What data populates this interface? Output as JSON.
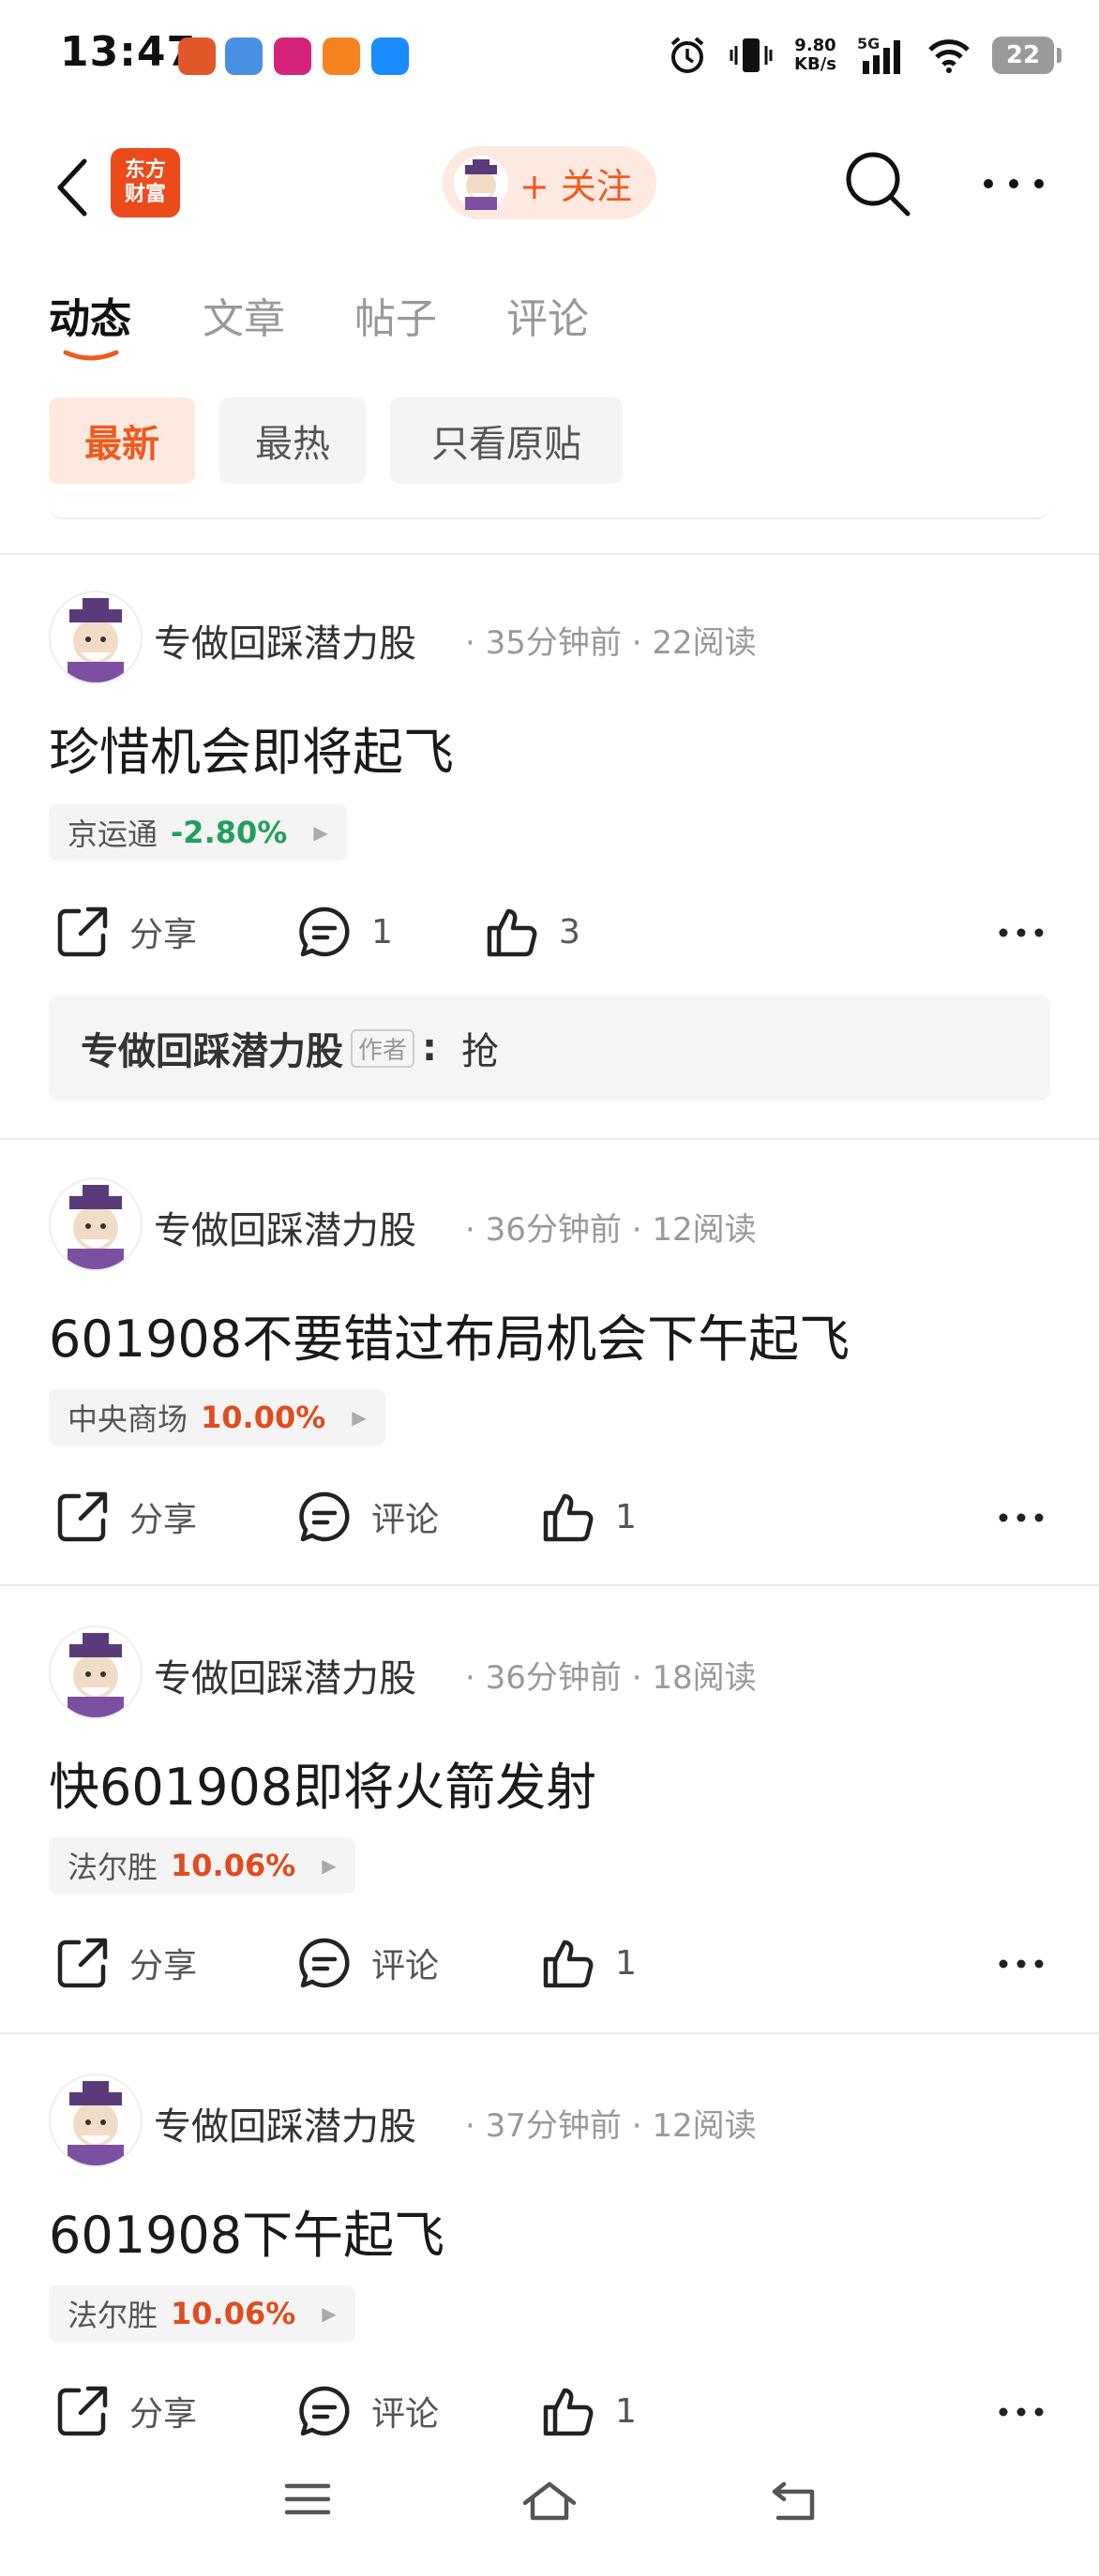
{
  "status_bar": {
    "time": "13:47",
    "net_speed": "9.80",
    "net_unit": "KB/s",
    "signal": "5G",
    "battery": "22"
  },
  "header": {
    "logo_text": "东方财富",
    "follow_label": "+ 关注"
  },
  "tabs": [
    {
      "label": "动态"
    },
    {
      "label": "文章"
    },
    {
      "label": "帖子"
    },
    {
      "label": "评论"
    }
  ],
  "filters": [
    {
      "label": "最新"
    },
    {
      "label": "最热"
    },
    {
      "label": "只看原贴"
    }
  ],
  "posts": [
    {
      "author": "专做回踩潜力股",
      "time": "35分钟前",
      "reads": "22阅读",
      "title": "珍惜机会即将起飞",
      "stock_name": "京运通",
      "stock_change": "-2.80%",
      "share": "分享",
      "comments": "1",
      "likes": "3",
      "reply_author": "专做回踩潜力股",
      "reply_tag": "作者",
      "reply_colon": ":",
      "reply_text": "抢"
    },
    {
      "author": "专做回踩潜力股",
      "time": "36分钟前",
      "reads": "12阅读",
      "title": "601908不要错过布局机会下午起飞",
      "stock_name": "中央商场",
      "stock_change": "10.00%",
      "share": "分享",
      "comments": "评论",
      "likes": "1"
    },
    {
      "author": "专做回踩潜力股",
      "time": "36分钟前",
      "reads": "18阅读",
      "title": "快601908即将火箭发射",
      "stock_name": "法尔胜",
      "stock_change": "10.06%",
      "share": "分享",
      "comments": "评论",
      "likes": "1"
    },
    {
      "author": "专做回踩潜力股",
      "time": "37分钟前",
      "reads": "12阅读",
      "title": "601908下午起飞",
      "stock_name": "法尔胜",
      "stock_change": "10.06%",
      "share": "分享",
      "comments": "评论",
      "likes": "1"
    }
  ],
  "colors": {
    "accent": "#ef5a1f",
    "up": "#e14c1e",
    "down": "#22a05b"
  }
}
